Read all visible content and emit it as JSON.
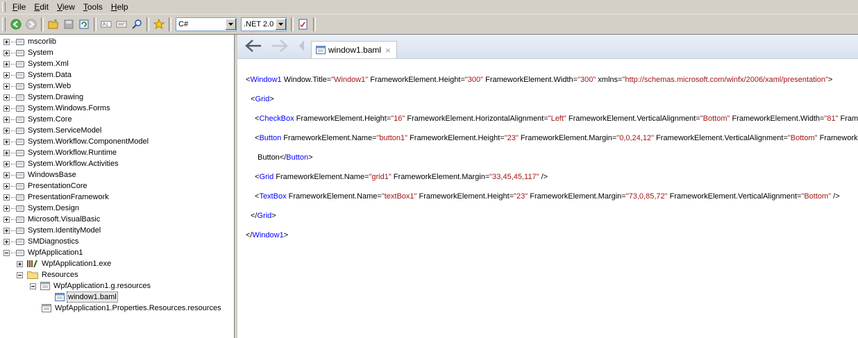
{
  "menu": [
    {
      "accel": "F",
      "rest": "ile"
    },
    {
      "accel": "E",
      "rest": "dit"
    },
    {
      "accel": "V",
      "rest": "iew"
    },
    {
      "accel": "T",
      "rest": "ools"
    },
    {
      "accel": "H",
      "rest": "elp"
    }
  ],
  "toolbar": {
    "language": "C#",
    "framework": ".NET 2.0"
  },
  "tree": {
    "assemblies": [
      "mscorlib",
      "System",
      "System.Xml",
      "System.Data",
      "System.Web",
      "System.Drawing",
      "System.Windows.Forms",
      "System.Core",
      "System.ServiceModel",
      "System.Workflow.ComponentModel",
      "System.Workflow.Runtime",
      "System.Workflow.Activities",
      "WindowsBase",
      "PresentationCore",
      "PresentationFramework",
      "System.Design",
      "Microsoft.VisualBasic",
      "System.IdentityModel",
      "SMDiagnostics",
      "WpfApplication1"
    ],
    "exe": "WpfApplication1.exe",
    "resources_folder": "Resources",
    "g_resources": "WpfApplication1.g.resources",
    "baml": "window1.baml",
    "props_resources": "WpfApplication1.Properties.Resources.resources"
  },
  "tab": {
    "label": "window1.baml",
    "close": "×"
  },
  "code": {
    "l1": {
      "o": "<",
      "tag": "Window1",
      "a1": " Window.Title=",
      "v1": "\"Window1\"",
      "a2": " FrameworkElement.Height=",
      "v2": "\"300\"",
      "a3": " FrameworkElement.Width=",
      "v3": "\"300\"",
      "a4": " xmlns=",
      "v4": "\"http://schemas.microsoft.com/winfx/2006/xaml/presentation\"",
      "c": ">"
    },
    "l2": {
      "o": "<",
      "tag": "Grid",
      "c": ">"
    },
    "l3": {
      "o": "<",
      "tag": "CheckBox",
      "a1": " FrameworkElement.Height=",
      "v1": "\"16\"",
      "a2": " FrameworkElement.HorizontalAlignment=",
      "v2": "\"Left\"",
      "a3": " FrameworkElement.VerticalAlignment=",
      "v3": "\"Bottom\"",
      "a4": " FrameworkElement.Width=",
      "v4": "\"81\"",
      "a5": " Framewo"
    },
    "l4": {
      "o": "<",
      "tag": "Button",
      "a1": " FrameworkElement.Name=",
      "v1": "\"button1\"",
      "a2": " FrameworkElement.Height=",
      "v2": "\"23\"",
      "a3": " FrameworkElement.Margin=",
      "v3": "\"0,0,24,12\"",
      "a4": " FrameworkElement.VerticalAlignment=",
      "v4": "\"Bottom\"",
      "a5": " FrameworkEler"
    },
    "l5": {
      "text": "Button",
      "o": "</",
      "tag": "Button",
      "c": ">"
    },
    "l6": {
      "o": "<",
      "tag": "Grid",
      "a1": " FrameworkElement.Name=",
      "v1": "\"grid1\"",
      "a2": " FrameworkElement.Margin=",
      "v2": "\"33,45,45,117\"",
      "c": " />"
    },
    "l7": {
      "o": "<",
      "tag": "TextBox",
      "a1": " FrameworkElement.Name=",
      "v1": "\"textBox1\"",
      "a2": " FrameworkElement.Height=",
      "v2": "\"23\"",
      "a3": " FrameworkElement.Margin=",
      "v3": "\"73,0,85,72\"",
      "a4": " FrameworkElement.VerticalAlignment=",
      "v4": "\"Bottom\"",
      "c": " />"
    },
    "l8": {
      "o": "</",
      "tag": "Grid",
      "c": ">"
    },
    "l9": {
      "o": "</",
      "tag": "Window1",
      "c": ">"
    }
  },
  "colors": {
    "tag": "#0000ff",
    "value": "#a31515",
    "selection": "#e8e8e8"
  }
}
